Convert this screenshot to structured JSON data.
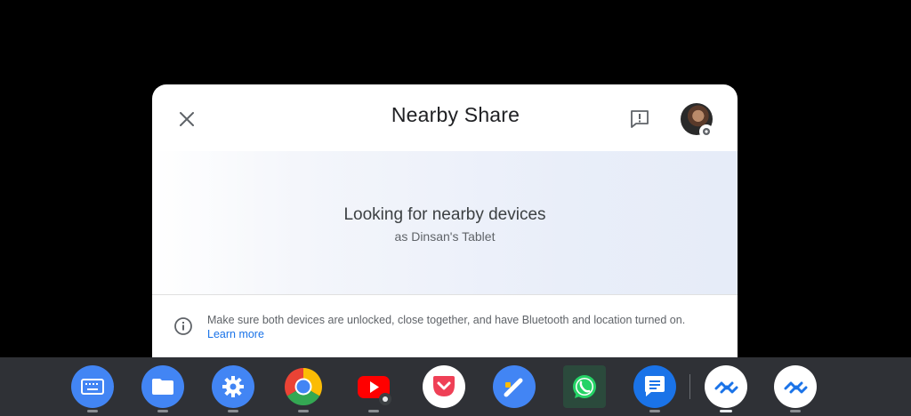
{
  "dialog": {
    "title": "Nearby Share",
    "status_title": "Looking for nearby devices",
    "status_subtitle": "as Dinsan's Tablet",
    "info_text": "Make sure both devices are unlocked, close together, and have Bluetooth and location turned on.",
    "learn_more": "Learn more"
  },
  "icons": {
    "close": "close-icon",
    "feedback": "feedback-icon",
    "avatar": "avatar",
    "info": "info-icon"
  },
  "shelf": {
    "apps": [
      {
        "name": "keyboard-app-icon",
        "color": "#4285f4"
      },
      {
        "name": "files-app-icon",
        "color": "#4285f4"
      },
      {
        "name": "settings-app-icon",
        "color": "#4285f4"
      },
      {
        "name": "chrome-app-icon",
        "color": "#ffffff"
      },
      {
        "name": "youtube-app-icon",
        "color": "#ff0000"
      },
      {
        "name": "pocket-app-icon",
        "color": "#ffffff"
      },
      {
        "name": "docs-editor-app-icon",
        "color": "#4285f4"
      },
      {
        "name": "whatsapp-app-icon",
        "color": "#25d366"
      },
      {
        "name": "messages-app-icon",
        "color": "#1a73e8"
      },
      {
        "name": "nearby-share-app-icon",
        "color": "#ffffff"
      },
      {
        "name": "nearby-share-app-icon-2",
        "color": "#ffffff"
      }
    ]
  },
  "colors": {
    "accent": "#1a73e8",
    "shelf": "#2f3136"
  }
}
